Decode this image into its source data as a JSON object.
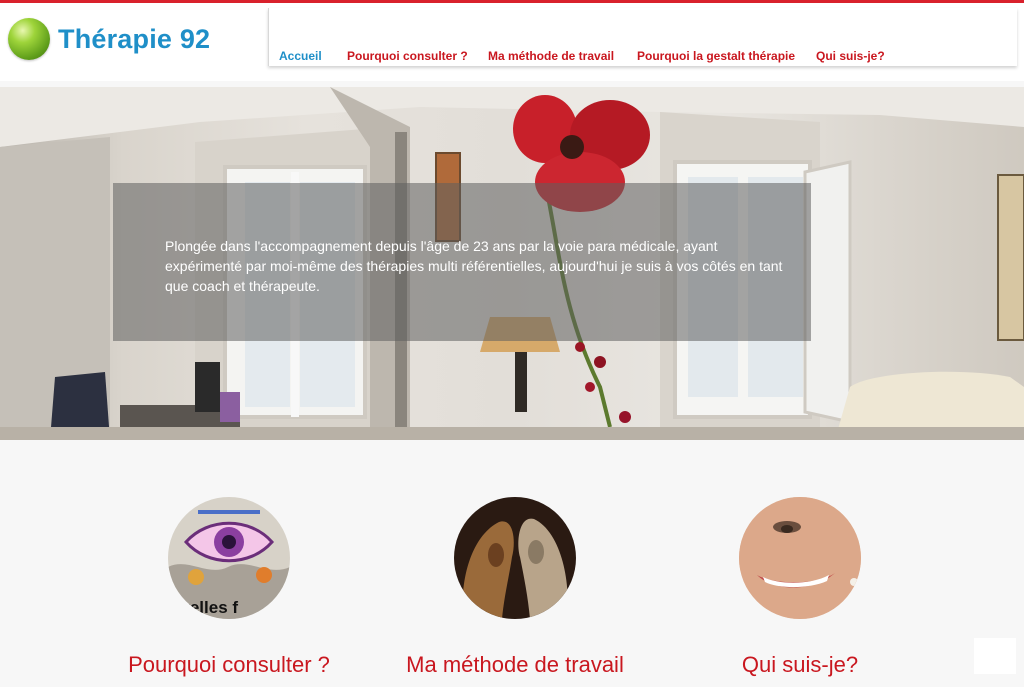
{
  "brand": {
    "name": "Thérapie 92",
    "logo_icon": "green-ball-icon",
    "color": "#1f8fc8"
  },
  "nav": {
    "items": [
      {
        "label": "Accueil",
        "active": true
      },
      {
        "label": "Pourquoi consulter ?",
        "active": false
      },
      {
        "label": "Ma méthode de travail",
        "active": false
      },
      {
        "label": "Pourquoi la gestalt thérapie",
        "active": false
      },
      {
        "label": "Qui suis-je?",
        "active": false
      }
    ],
    "active_color": "#1f8fc8",
    "link_color": "#c9171f"
  },
  "hero": {
    "text": "Plongée dans l'accompagnement depuis l'âge de 23 ans par la voie para médicale, ayant expérimenté par moi-même des thérapies multi référentielles, aujourd'hui je suis à vos côtés en tant que coach et thérapeute."
  },
  "cards": [
    {
      "title": "Pourquoi consulter ?",
      "image_caption": "uvelles f",
      "image": "eye-illustration"
    },
    {
      "title": "Ma méthode de travail",
      "image": "two-faces-illustration"
    },
    {
      "title": "Qui suis-je?",
      "image": "portrait-photo"
    }
  ]
}
